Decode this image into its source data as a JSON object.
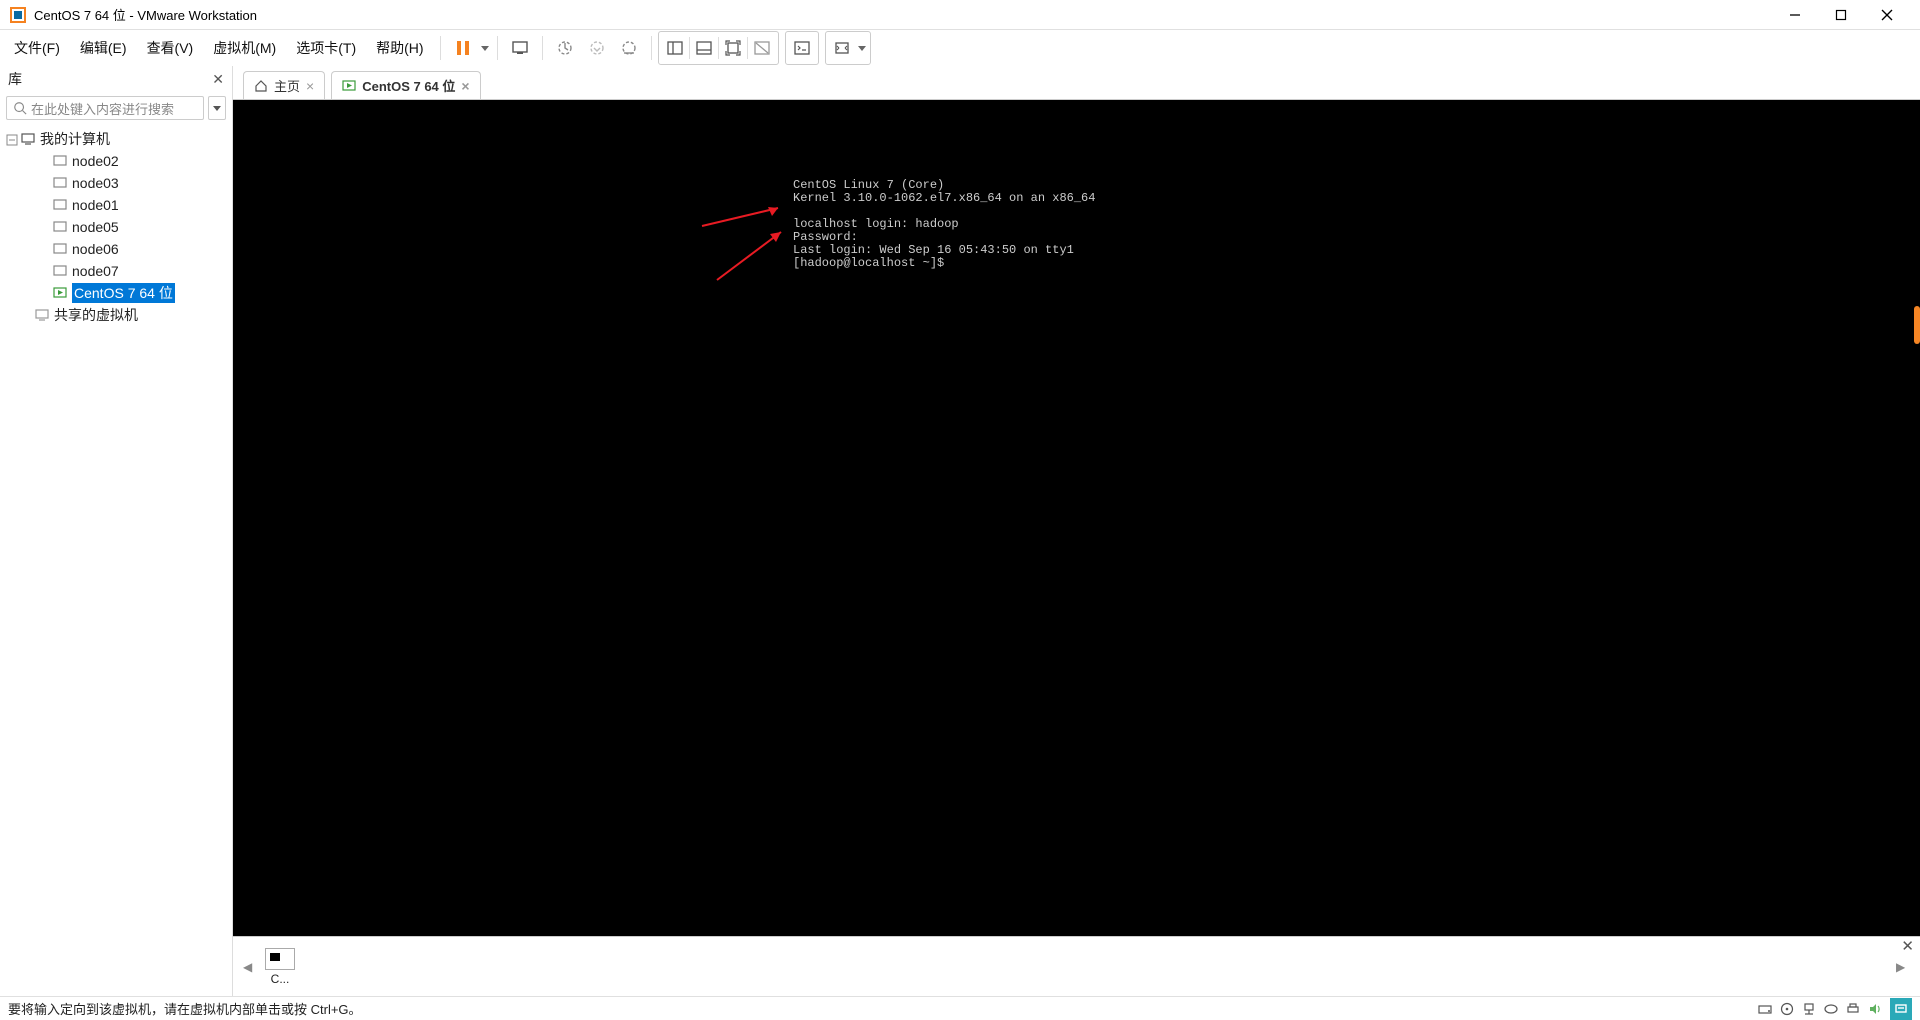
{
  "titlebar": {
    "title": "CentOS 7 64 位 - VMware Workstation"
  },
  "menubar": {
    "items": [
      {
        "label": "文件(F)"
      },
      {
        "label": "编辑(E)"
      },
      {
        "label": "查看(V)"
      },
      {
        "label": "虚拟机(M)"
      },
      {
        "label": "选项卡(T)"
      },
      {
        "label": "帮助(H)"
      }
    ]
  },
  "sidebar": {
    "title": "库",
    "search_placeholder": "在此处键入内容进行搜索",
    "root_label": "我的计算机",
    "nodes": [
      {
        "label": "node02"
      },
      {
        "label": "node03"
      },
      {
        "label": "node01"
      },
      {
        "label": "node05"
      },
      {
        "label": "node06"
      },
      {
        "label": "node07"
      }
    ],
    "selected_label": "CentOS 7 64 位",
    "shared_label": "共享的虚拟机"
  },
  "tabs": {
    "home_label": "主页",
    "active_label": "CentOS 7 64 位"
  },
  "console": {
    "lines": "CentOS Linux 7 (Core)\nKernel 3.10.0-1062.el7.x86_64 on an x86_64\n\nlocalhost login: hadoop\nPassword:\nLast login: Wed Sep 16 05:43:50 on tty1\n[hadoop@localhost ~]$"
  },
  "thumb": {
    "label": "C..."
  },
  "statusbar": {
    "text": "要将输入定向到该虚拟机，请在虚拟机内部单击或按 Ctrl+G。"
  }
}
